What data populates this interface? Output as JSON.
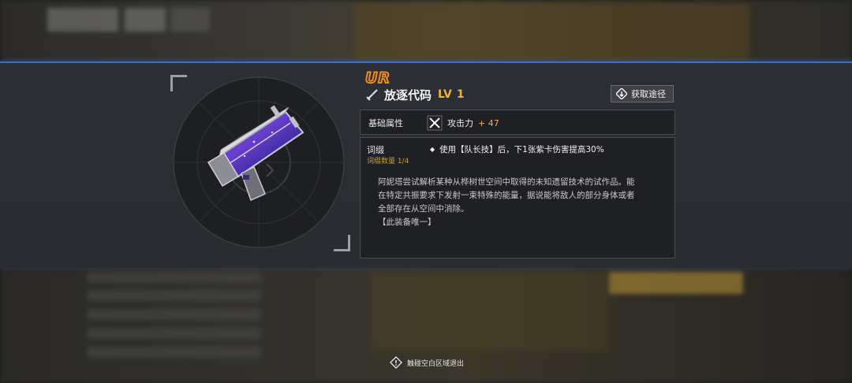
{
  "item": {
    "rarity": "UR",
    "name": "放逐代码",
    "level_label": "LV",
    "level": "1",
    "icon": "weapon-sword-icon",
    "rarity_color": "#f08a1e",
    "accent_color": "#f0b23a"
  },
  "acquire_button": {
    "label": "获取途径",
    "icon": "diamond-arrow-icon"
  },
  "base_attributes": {
    "label": "基础属性",
    "stat_icon": "crossed-swords-icon",
    "stat_name": "攻击力",
    "stat_value": "+ 47"
  },
  "affix": {
    "label": "词缀",
    "count_text": "词缀数量 1/4",
    "effect": "使用【队长技】后，下1张紫卡伤害提高30%"
  },
  "description": {
    "lines": [
      "阿妮塔尝试解析某种从桦树世空间中取得的未知遗留技术的试作品。能",
      "在特定共振要求下发射一束特殊的能量，据说能将敌人的部分身体或者",
      "全部存在从空间中消除。"
    ],
    "unique_note": "【此装备唯一】"
  },
  "footer": {
    "hint": "触碰空白区域退出",
    "icon": "warning-diamond-icon"
  }
}
